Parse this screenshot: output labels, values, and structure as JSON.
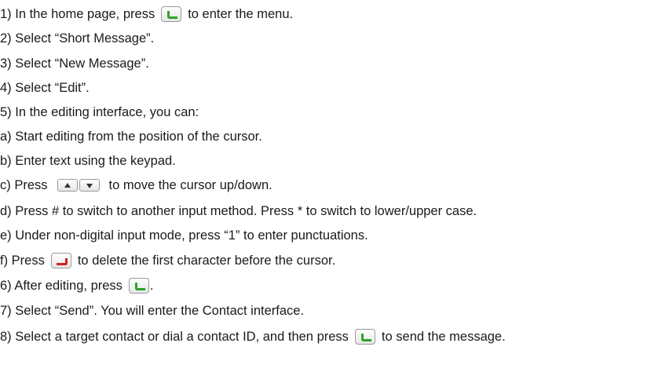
{
  "steps": {
    "s1": {
      "before": "1) In the home page, press",
      "after": "to enter the menu."
    },
    "s2": {
      "text": "2) Select “Short Message”."
    },
    "s3": {
      "text": "3) Select “New Message”."
    },
    "s4": {
      "text": "4) Select “Edit”."
    },
    "s5": {
      "text": "5) In the editing interface, you can:"
    },
    "a": {
      "text": "a) Start editing from the position of the cursor."
    },
    "b": {
      "text": "b) Enter text using the keypad."
    },
    "c": {
      "before": "c) Press",
      "after": "to move the cursor up/down."
    },
    "d": {
      "text": "d) Press # to switch to another input method. Press * to switch to lower/upper case."
    },
    "e": {
      "text": "e) Under non-digital input mode, press “1” to enter punctuations."
    },
    "f": {
      "before": "f) Press",
      "after": "to delete the first character before the cursor."
    },
    "s6": {
      "before": "6) After editing, press",
      "after": "."
    },
    "s7": {
      "text": "7) Select “Send”. You will enter the Contact interface."
    },
    "s8": {
      "before": "8) Select a target contact or dial a contact ID, and then press",
      "after": "to send the message."
    }
  },
  "icons": {
    "call_key": "green-call-key-icon",
    "end_key": "red-end-key-icon",
    "nav_keys": "up-down-nav-keys-icon"
  },
  "colors": {
    "call_key": "#2aa52a",
    "end_key": "#d32020",
    "text": "#1a1a1a"
  }
}
